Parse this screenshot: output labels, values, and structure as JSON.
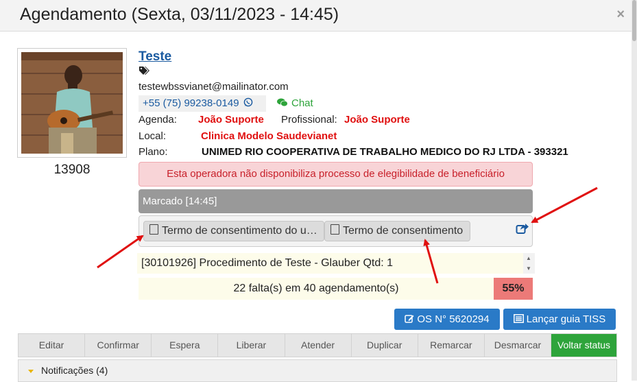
{
  "modal": {
    "title": "Agendamento (Sexta, 03/11/2023 - 14:45)",
    "close_symbol": "×"
  },
  "patient": {
    "id": "13908",
    "name": "Teste",
    "email": "testewbssvianet@mailinator.com",
    "phone": "+55 (75) 99238-0149",
    "chat_label": "Chat",
    "agenda_label": "Agenda:",
    "agenda_value": "João Suporte",
    "profissional_label": "Profissional:",
    "profissional_value": "João Suporte",
    "local_label": "Local:",
    "local_value": "Clinica Modelo Saudevianet",
    "plano_label": "Plano:",
    "plano_value": "UNIMED RIO COOPERATIVA DE TRABALHO MEDICO DO RJ LTDA - 393321"
  },
  "alert_text": "Esta operadora não disponibiliza processo de elegibilidade de beneficiário",
  "status_text": "Marcado [14:45]",
  "documents": [
    {
      "label": "Termo de consentimento do u…"
    },
    {
      "label": "Termo de consentimento"
    }
  ],
  "procedure_text": "[30101926] Procedimento de Teste - Glauber Qtd: 1",
  "absences": {
    "text": "22 falta(s) em 40 agendamento(s)",
    "percent": "55%"
  },
  "buttons": {
    "os": "OS N° 5620294",
    "tiss": "Lançar guia TISS"
  },
  "actions": [
    "Editar",
    "Confirmar",
    "Espera",
    "Liberar",
    "Atender",
    "Duplicar",
    "Remarcar",
    "Desmarcar",
    "Voltar status"
  ],
  "notifications_label": "Notificações (4)",
  "colors": {
    "link_blue": "#1a5aa0",
    "alert_red": "#c8202a",
    "status_gray": "#999999",
    "primary_button": "#2a7ac7",
    "success_green": "#2ea43b",
    "percent_bg": "#ec7a78",
    "annotation_arrow": "#e01010"
  },
  "icons": [
    "close-icon",
    "tags-icon",
    "whatsapp-icon",
    "chat-icon",
    "file-icon",
    "share-icon",
    "edit-icon",
    "list-icon",
    "caret-down-icon"
  ]
}
